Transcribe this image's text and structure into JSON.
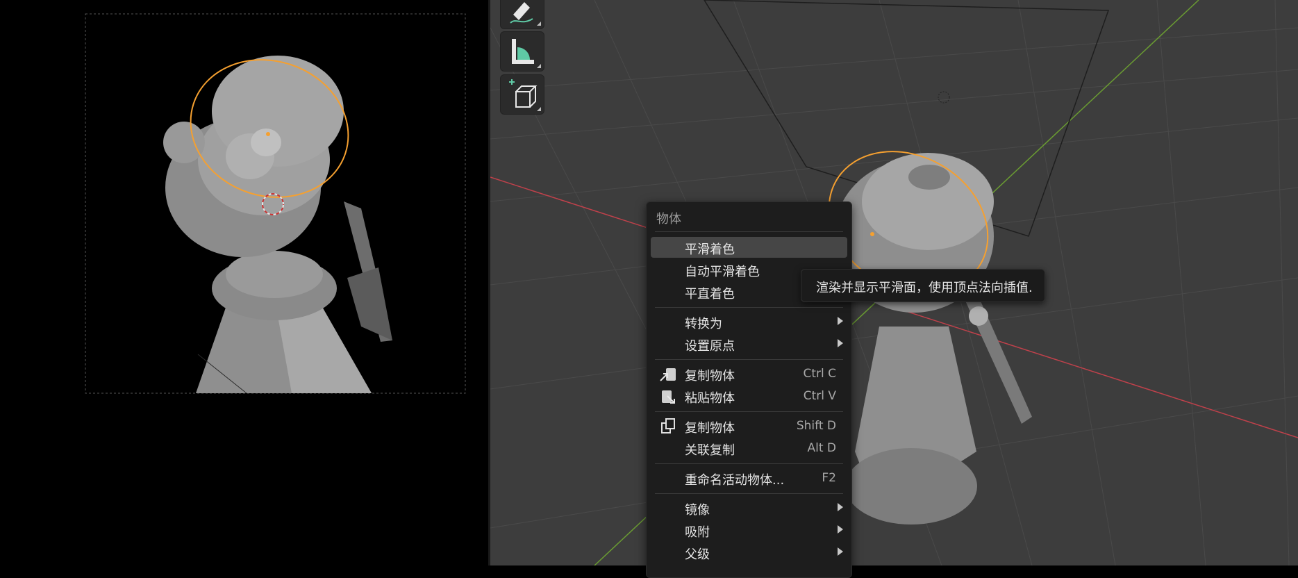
{
  "context_menu": {
    "title": "物体",
    "items": [
      {
        "label": "平滑着色",
        "shortcut": "",
        "highlighted": true
      },
      {
        "label": "自动平滑着色",
        "shortcut": ""
      },
      {
        "label": "平直着色",
        "shortcut": ""
      },
      {
        "label": "转换为",
        "submenu": true
      },
      {
        "label": "设置原点",
        "submenu": true
      },
      {
        "label": "复制物体",
        "shortcut": "Ctrl C",
        "icon": "copy-to-clipboard-icon"
      },
      {
        "label": "粘贴物体",
        "shortcut": "Ctrl V",
        "icon": "paste-from-clipboard-icon"
      },
      {
        "label": "复制物体",
        "shortcut": "Shift D",
        "icon": "duplicate-icon"
      },
      {
        "label": "关联复制",
        "shortcut": "Alt D"
      },
      {
        "label": "重命名活动物体...",
        "shortcut": "F2"
      },
      {
        "label": "镜像",
        "submenu": true
      },
      {
        "label": "吸附",
        "submenu": true
      },
      {
        "label": "父级",
        "submenu": true
      }
    ]
  },
  "tooltip": {
    "text": "渲染并显示平滑面，使用顶点法向插值."
  },
  "toolbar": {
    "tools": [
      "annotate-icon",
      "measure-icon",
      "add-cube-icon"
    ]
  },
  "colors": {
    "viewport_bg": "#3d3d3d",
    "camera_view_bg": "#000000",
    "selection_outline": "#f5a030",
    "menu_bg": "#1d1d1d",
    "menu_highlight": "#464646",
    "x_axis": "#c0414b",
    "y_axis": "#6a9c32"
  }
}
